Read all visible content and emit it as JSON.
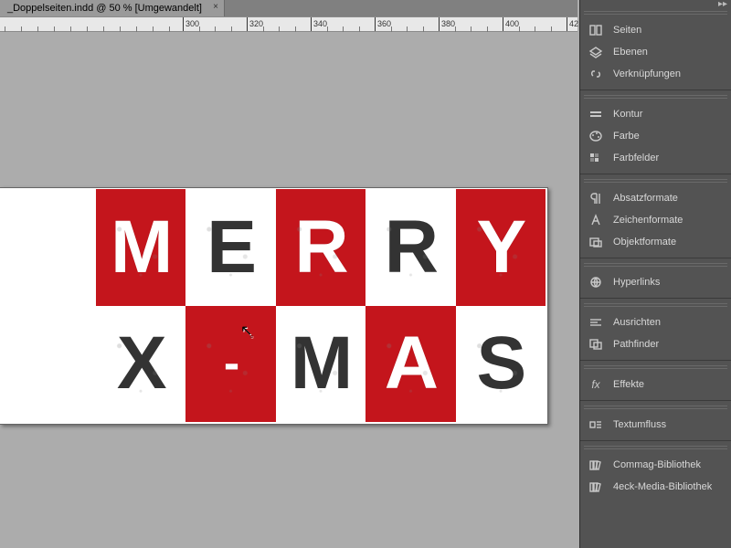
{
  "tab": {
    "title": "_Doppelseiten.indd @ 50 % [Umgewandelt]"
  },
  "ruler_ticks": [
    "300",
    "320",
    "340",
    "360",
    "380",
    "400",
    "42"
  ],
  "artwork": {
    "row1": [
      "M",
      "E",
      "R",
      "R",
      "Y"
    ],
    "row2": [
      "X",
      "-",
      "M",
      "A",
      "S"
    ]
  },
  "panels": [
    {
      "group": [
        {
          "icon": "pages",
          "label": "Seiten"
        },
        {
          "icon": "layers",
          "label": "Ebenen"
        },
        {
          "icon": "links",
          "label": "Verknüpfungen"
        }
      ]
    },
    {
      "group": [
        {
          "icon": "stroke",
          "label": "Kontur"
        },
        {
          "icon": "palette",
          "label": "Farbe"
        },
        {
          "icon": "swatches",
          "label": "Farbfelder"
        }
      ]
    },
    {
      "group": [
        {
          "icon": "para",
          "label": "Absatzformate"
        },
        {
          "icon": "char",
          "label": "Zeichenformate"
        },
        {
          "icon": "obj",
          "label": "Objektformate"
        }
      ]
    },
    {
      "group": [
        {
          "icon": "hyperlink",
          "label": "Hyperlinks"
        }
      ]
    },
    {
      "group": [
        {
          "icon": "align",
          "label": "Ausrichten"
        },
        {
          "icon": "pathfinder",
          "label": "Pathfinder"
        }
      ]
    },
    {
      "group": [
        {
          "icon": "fx",
          "label": "Effekte"
        }
      ]
    },
    {
      "group": [
        {
          "icon": "textwrap",
          "label": "Textumfluss"
        }
      ]
    },
    {
      "group": [
        {
          "icon": "lib",
          "label": "Commag-Bibliothek"
        },
        {
          "icon": "lib",
          "label": "4eck-Media-Bibliothek"
        }
      ]
    }
  ]
}
